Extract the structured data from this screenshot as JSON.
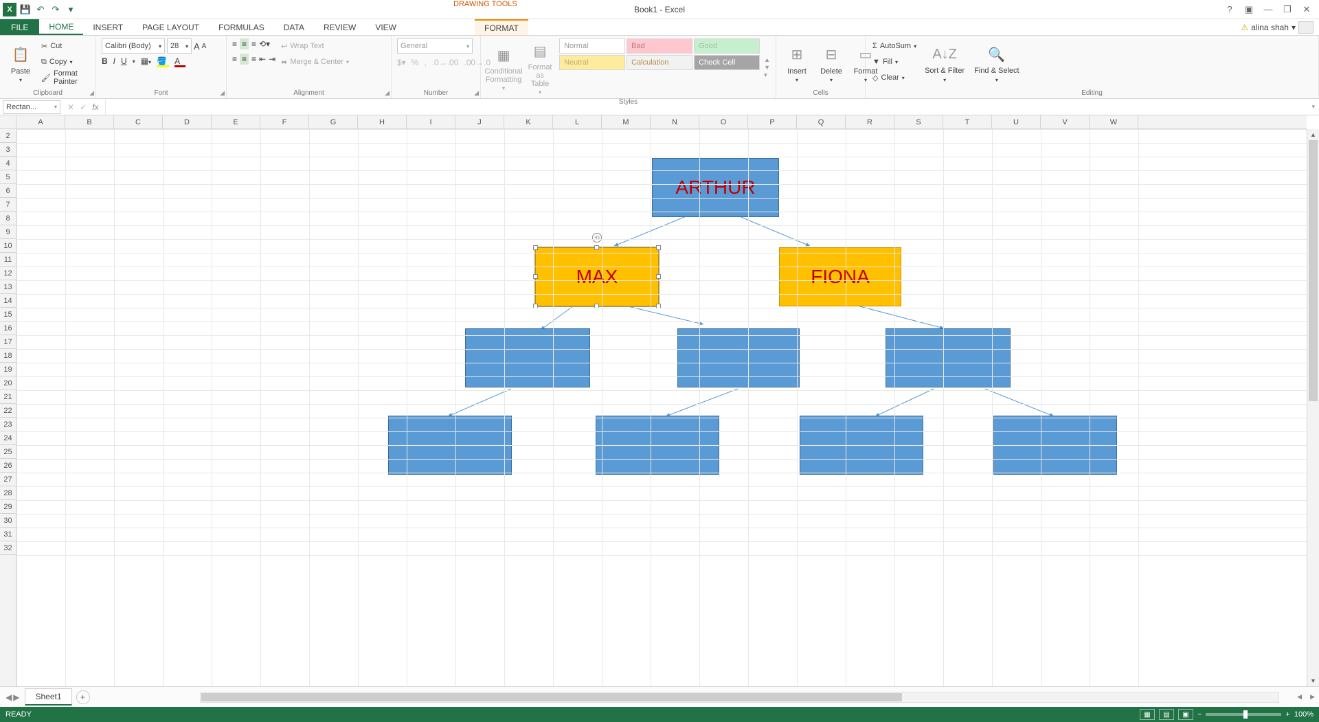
{
  "app": {
    "title": "Book1 - Excel",
    "context_tab_group": "DRAWING TOOLS"
  },
  "qat": {
    "save": "💾",
    "undo": "↶",
    "redo": "↷",
    "customize": "▾"
  },
  "window_controls": {
    "help": "?",
    "ribbon_opts": "▣",
    "minimize": "—",
    "restore": "❐",
    "close": "✕"
  },
  "tabs": {
    "file": "FILE",
    "home": "HOME",
    "insert": "INSERT",
    "page_layout": "PAGE LAYOUT",
    "formulas": "FORMULAS",
    "data": "DATA",
    "review": "REVIEW",
    "view": "VIEW",
    "format": "FORMAT"
  },
  "account": {
    "name": "alina shah",
    "menu": "▾"
  },
  "ribbon": {
    "clipboard": {
      "label": "Clipboard",
      "paste": "Paste",
      "cut": "Cut",
      "copy": "Copy",
      "painter": "Format Painter"
    },
    "font": {
      "label": "Font",
      "name": "Calibri (Body)",
      "size": "28",
      "grow": "A",
      "shrink": "A",
      "bold": "B",
      "italic": "I",
      "underline": "U"
    },
    "alignment": {
      "label": "Alignment",
      "wrap": "Wrap Text",
      "merge": "Merge & Center"
    },
    "number": {
      "label": "Number",
      "format": "General"
    },
    "styles": {
      "label": "Styles",
      "conditional": "Conditional Formatting",
      "table": "Format as Table",
      "normal": "Normal",
      "bad": "Bad",
      "good": "Good",
      "neutral": "Neutral",
      "calculation": "Calculation",
      "check": "Check Cell"
    },
    "cells": {
      "label": "Cells",
      "insert": "Insert",
      "delete": "Delete",
      "format": "Format"
    },
    "editing": {
      "label": "Editing",
      "autosum": "AutoSum",
      "fill": "Fill",
      "clear": "Clear",
      "sort": "Sort & Filter",
      "find": "Find & Select"
    }
  },
  "formula_bar": {
    "name_box": "Rectan...",
    "fx": "fx"
  },
  "columns": [
    "A",
    "B",
    "C",
    "D",
    "E",
    "F",
    "G",
    "H",
    "I",
    "J",
    "K",
    "L",
    "M",
    "N",
    "O",
    "P",
    "Q",
    "R",
    "S",
    "T",
    "U",
    "V",
    "W"
  ],
  "rows_start": 2,
  "rows_end": 32,
  "shapes": {
    "arthur": "ARTHUR",
    "max": "MAX",
    "fiona": "FIONA"
  },
  "sheet": {
    "name": "Sheet1"
  },
  "status": {
    "ready": "READY",
    "zoom": "100%"
  }
}
